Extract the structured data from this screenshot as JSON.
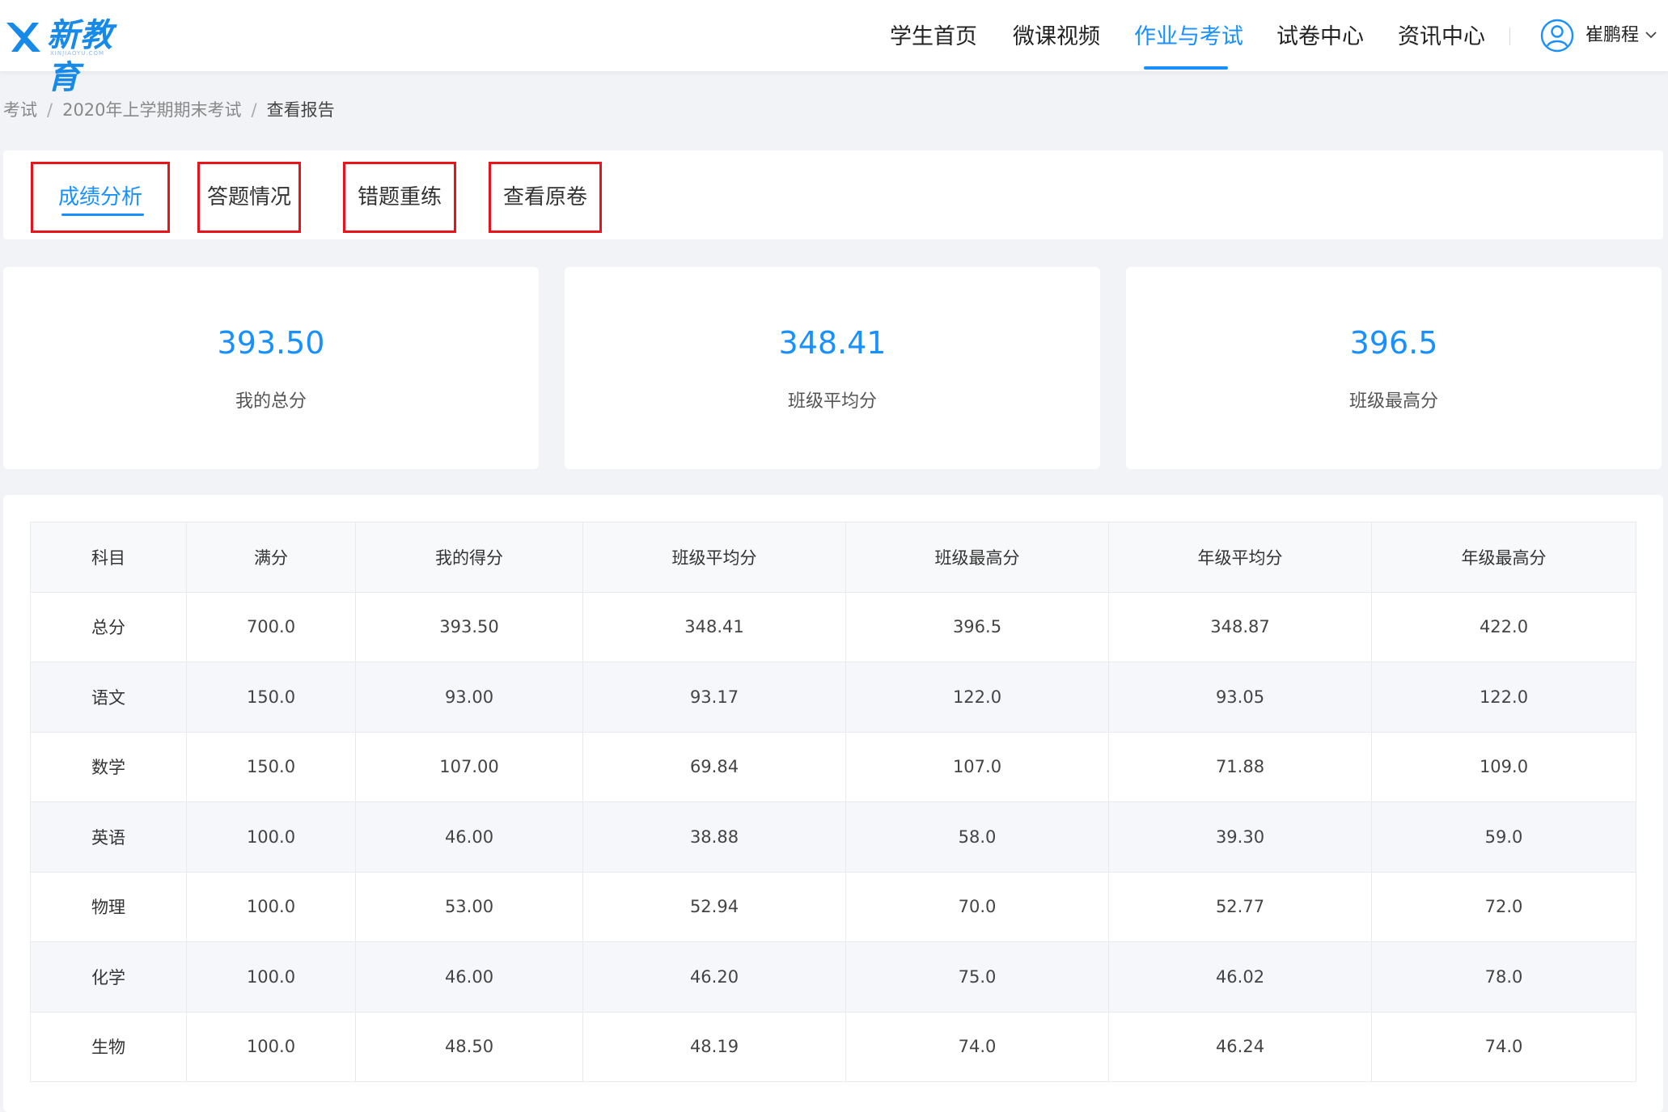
{
  "header": {
    "logo_text": "新教育",
    "logo_sub": "XINJIAOYU.COM",
    "nav": [
      {
        "label": "学生首页",
        "active": false
      },
      {
        "label": "微课视频",
        "active": false
      },
      {
        "label": "作业与考试",
        "active": true
      },
      {
        "label": "试卷中心",
        "active": false
      },
      {
        "label": "资讯中心",
        "active": false
      }
    ],
    "user_name": "崔鹏程"
  },
  "breadcrumb": {
    "items": [
      "考试",
      "2020年上学期期末考试",
      "查看报告"
    ],
    "separator": "/"
  },
  "tabs": [
    {
      "label": "成绩分析",
      "active": true
    },
    {
      "label": "答题情况",
      "active": false
    },
    {
      "label": "错题重练",
      "active": false
    },
    {
      "label": "查看原卷",
      "active": false
    }
  ],
  "stats": [
    {
      "value": "393.50",
      "label": "我的总分"
    },
    {
      "value": "348.41",
      "label": "班级平均分"
    },
    {
      "value": "396.5",
      "label": "班级最高分"
    }
  ],
  "table": {
    "headers": [
      "科目",
      "满分",
      "我的得分",
      "班级平均分",
      "班级最高分",
      "年级平均分",
      "年级最高分"
    ],
    "rows": [
      [
        "总分",
        "700.0",
        "393.50",
        "348.41",
        "396.5",
        "348.87",
        "422.0"
      ],
      [
        "语文",
        "150.0",
        "93.00",
        "93.17",
        "122.0",
        "93.05",
        "122.0"
      ],
      [
        "数学",
        "150.0",
        "107.00",
        "69.84",
        "107.0",
        "71.88",
        "109.0"
      ],
      [
        "英语",
        "100.0",
        "46.00",
        "38.88",
        "58.0",
        "39.30",
        "59.0"
      ],
      [
        "物理",
        "100.0",
        "53.00",
        "52.94",
        "70.0",
        "52.77",
        "72.0"
      ],
      [
        "化学",
        "100.0",
        "46.00",
        "46.20",
        "75.0",
        "46.02",
        "78.0"
      ],
      [
        "生物",
        "100.0",
        "48.50",
        "48.19",
        "74.0",
        "46.24",
        "74.0"
      ]
    ]
  },
  "colors": {
    "accent": "#1890ff",
    "highlight_box": "#e8141c",
    "background": "#f1f3f6"
  }
}
